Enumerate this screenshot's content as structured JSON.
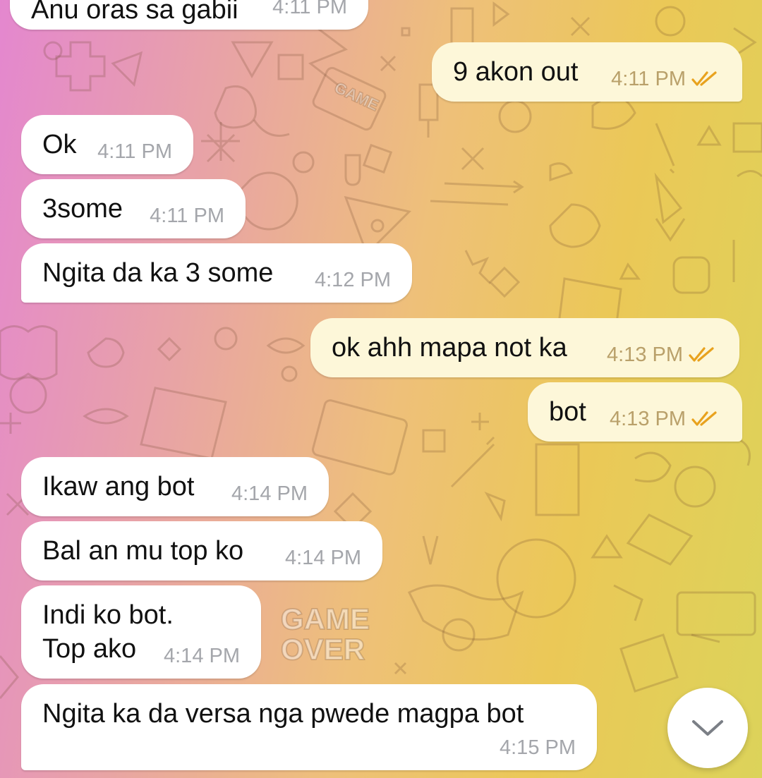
{
  "chat": {
    "messages": [
      {
        "text": "Anu oras sa gabii",
        "time": "4:11 PM",
        "dir": "in"
      },
      {
        "text": "9 akon out",
        "time": "4:11 PM",
        "dir": "out"
      },
      {
        "text": "Ok",
        "time": "4:11 PM",
        "dir": "in"
      },
      {
        "text": "3some",
        "time": "4:11 PM",
        "dir": "in"
      },
      {
        "text": "Ngita da ka 3 some",
        "time": "4:12 PM",
        "dir": "in"
      },
      {
        "text": "ok ahh mapa not ka",
        "time": "4:13 PM",
        "dir": "out"
      },
      {
        "text": "bot",
        "time": "4:13 PM",
        "dir": "out"
      },
      {
        "text": "Ikaw ang bot",
        "time": "4:14 PM",
        "dir": "in"
      },
      {
        "text": "Bal an mu top ko",
        "time": "4:14 PM",
        "dir": "in"
      },
      {
        "lines": [
          "Indi ko bot.",
          "Top ako"
        ],
        "time": "4:14 PM",
        "dir": "in"
      },
      {
        "text": "Ngita ka da versa nga pwede magpa bot",
        "time": "4:15 PM",
        "dir": "in"
      }
    ]
  },
  "background": {
    "sticker_lines": [
      "GAME",
      "OVER"
    ],
    "cartridge_label": "GAME"
  },
  "icons": {
    "read_receipt": "double-check-icon",
    "scroll_down": "chevron-down-icon"
  },
  "colors": {
    "incoming_bubble": "#ffffff",
    "outgoing_bubble": "#fdf7d9",
    "read_check": "#e8a21e"
  }
}
